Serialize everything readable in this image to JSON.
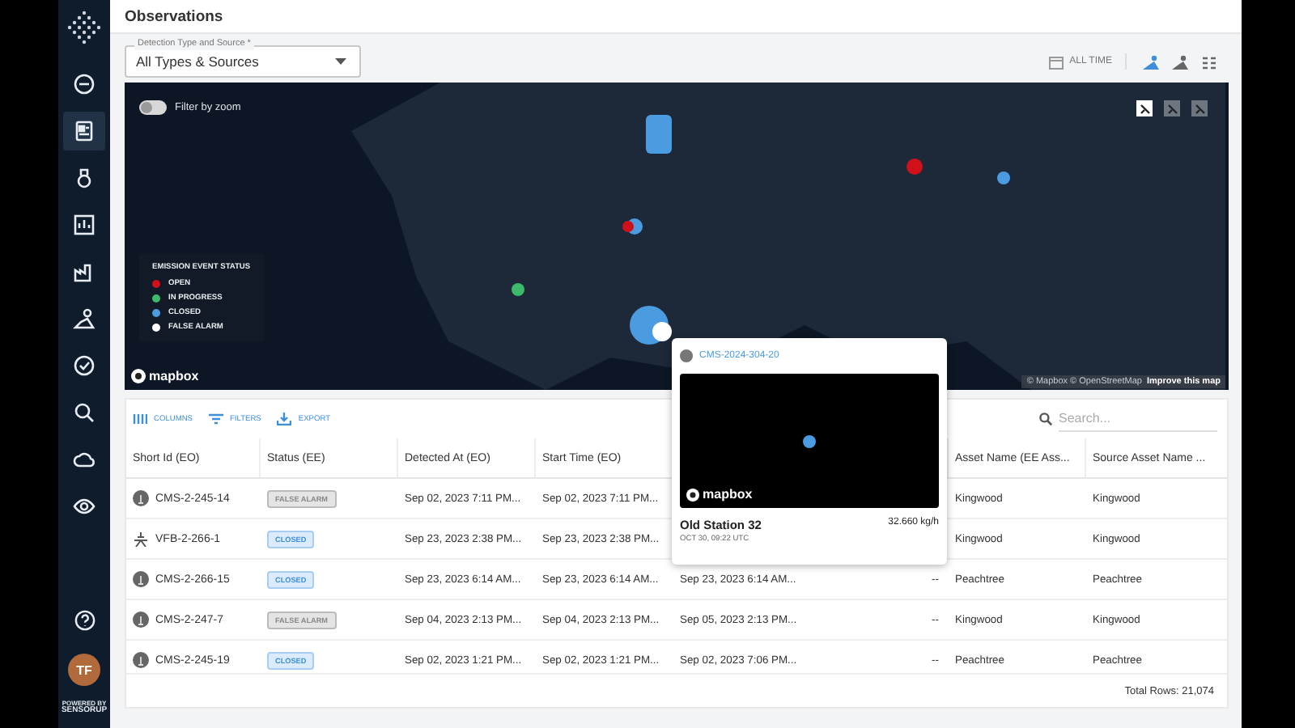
{
  "header": {
    "title": "Observations"
  },
  "filter": {
    "label": "Detection Type and Source *",
    "value": "All Types & Sources"
  },
  "time_range": {
    "label": "ALL TIME"
  },
  "view_modes": [
    {
      "selected": true
    },
    {
      "selected": false
    },
    {
      "selected": false
    }
  ],
  "sidebar": {
    "items": [
      {
        "selected": false
      },
      {
        "selected": true
      },
      {
        "selected": false
      },
      {
        "selected": false
      },
      {
        "selected": false
      },
      {
        "selected": false
      },
      {
        "selected": false
      },
      {
        "selected": false
      },
      {
        "selected": false
      },
      {
        "selected": false
      }
    ],
    "avatar": "TF",
    "powered_by": "POWERED BY",
    "brand": "SENSORUP"
  },
  "map": {
    "filter_by_zoom": {
      "label": "Filter by zoom",
      "on": false
    },
    "controls": [
      {
        "selected": true
      },
      {
        "selected": false
      },
      {
        "selected": false
      }
    ],
    "legend": {
      "title": "EMISSION EVENT STATUS",
      "items": [
        {
          "label": "OPEN",
          "color": "#d0101b"
        },
        {
          "label": "IN PROGRESS",
          "color": "#3cb96b"
        },
        {
          "label": "CLOSED",
          "color": "#4a9be0"
        },
        {
          "label": "FALSE ALARM",
          "color": "#ffffff"
        }
      ]
    },
    "logo": "mapbox",
    "attribution": "© Mapbox © OpenStreetMap",
    "improve_link": "Improve this map"
  },
  "table": {
    "toolbar": [
      "COLUMNS",
      "FILTERS",
      "EXPORT"
    ],
    "search": {
      "placeholder": "Search..."
    },
    "columns": [
      "Short Id (EO)",
      "Status (EE)",
      "Detected At (EO)",
      "Start Time (EO)",
      null,
      null,
      "Asset Name (EE Ass...",
      "Source Asset Name ..."
    ],
    "rows": [
      {
        "kind": "round",
        "cells": [
          "CMS-2-245-14",
          {
            "label": "FALSE ALARM",
            "kind": "grey"
          },
          "Sep 02, 2023 7:11 PM...",
          "Sep 02, 2023 7:11 PM...",
          null,
          null,
          "Kingwood",
          "Kingwood"
        ]
      },
      {
        "kind": "tripod",
        "cells": [
          "VFB-2-266-1",
          {
            "label": "CLOSED",
            "kind": "blue"
          },
          "Sep 23, 2023 2:38 PM...",
          "Sep 23, 2023 2:38 PM...",
          null,
          null,
          "Kingwood",
          "Kingwood"
        ]
      },
      {
        "kind": "round",
        "cells": [
          "CMS-2-266-15",
          {
            "label": "CLOSED",
            "kind": "blue"
          },
          "Sep 23, 2023 6:14 AM...",
          "Sep 23, 2023 6:14 AM...",
          "Sep 23, 2023 6:14 AM...",
          "--",
          "Peachtree",
          "Peachtree"
        ]
      },
      {
        "kind": "round",
        "cells": [
          "CMS-2-247-7",
          {
            "label": "FALSE ALARM",
            "kind": "grey"
          },
          "Sep 04, 2023 2:13 PM...",
          "Sep 04, 2023 2:13 PM...",
          "Sep 05, 2023 2:13 PM...",
          "--",
          "Kingwood",
          "Kingwood"
        ]
      },
      {
        "kind": "round",
        "cells": [
          "CMS-2-245-19",
          {
            "label": "CLOSED",
            "kind": "blue"
          },
          "Sep 02, 2023 1:21 PM...",
          "Sep 02, 2023 1:21 PM...",
          "Sep 02, 2023 7:06 PM...",
          "--",
          "Peachtree",
          "Peachtree"
        ]
      }
    ],
    "total": "Total Rows: 21,074"
  },
  "popup": {
    "id": "CMS-2024-304-20",
    "logo": "mapbox",
    "name": "Old Station 32",
    "rate": "32.660 kg/h",
    "time": "OCT 30, 09:22 UTC"
  }
}
